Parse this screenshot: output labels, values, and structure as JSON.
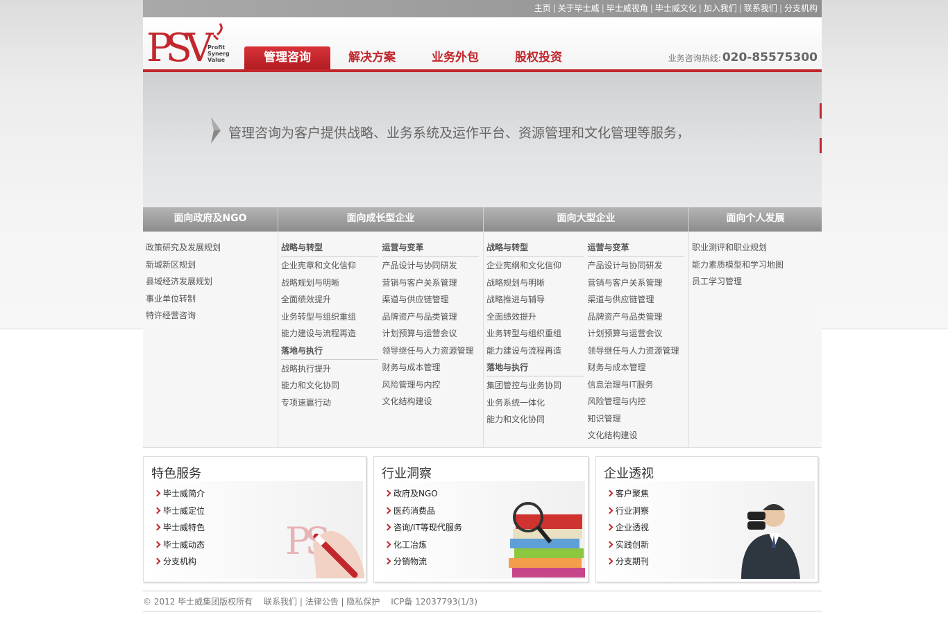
{
  "topbar": {
    "links": [
      "主页",
      "关于毕士威",
      "毕士威视角",
      "毕士威文化",
      "加入我们",
      "联系我们",
      "分支机构"
    ]
  },
  "logo": {
    "mark": "PSV",
    "tagline1": "Profit",
    "tagline2": "Synergy",
    "tagline3": "Value"
  },
  "nav": [
    {
      "label": "管理咨询"
    },
    {
      "label": "解决方案"
    },
    {
      "label": "业务外包"
    },
    {
      "label": "股权投资"
    }
  ],
  "hotline": {
    "label": "业务咨询热线:",
    "number": "020-85575300"
  },
  "banner": {
    "text": "管理咨询为客户提供战略、业务系统及运作平台、资源管理和文化管理等服务，"
  },
  "categories": [
    {
      "title": "面向政府及NGO",
      "items": [
        "政策研究及发展规划",
        "新城新区规划",
        "县域经济发展规划",
        "事业单位转制",
        "特许经营咨询"
      ]
    },
    {
      "title": "面向成长型企业",
      "left": {
        "head1": "战略与转型",
        "items1": [
          "企业宪章和文化信仰",
          "战略规划与明晰",
          "全面绩效提升",
          "业务转型与组织重组",
          "能力建设与流程再造"
        ],
        "head2": "落地与执行",
        "items2": [
          "战略执行提升",
          "能力和文化协同",
          "专项速赢行动"
        ]
      },
      "right": {
        "head1": "运营与变革",
        "items1": [
          "产品设计与协同研发",
          "营销与客户关系管理",
          "渠道与供应链管理",
          "品牌资产与品类管理",
          "计划预算与运营会议",
          "领导继任与人力资源管理",
          "财务与成本管理",
          "风险管理与内控",
          "文化结构建设"
        ]
      }
    },
    {
      "title": "面向大型企业",
      "left": {
        "head1": "战略与转型",
        "items1": [
          "企业宪纲和文化信仰",
          "战略规划与明晰",
          "战略推进与辅导",
          "全面绩效提升",
          "业务转型与组织重组",
          "能力建设与流程再造"
        ],
        "head2": "落地与执行",
        "items2": [
          "集团管控与业务协同",
          "业务系统一体化",
          "能力和文化协同"
        ]
      },
      "right": {
        "head1": "运营与变革",
        "items1": [
          "产品设计与协同研发",
          "营销与客户关系管理",
          "渠道与供应链管理",
          "品牌资产与品类管理",
          "计划预算与运营会议",
          "领导继任与人力资源管理",
          "财务与成本管理",
          "信息治理与IT服务",
          "风险管理与内控",
          "知识管理",
          "文化结构建设"
        ]
      }
    },
    {
      "title": "面向个人发展",
      "items": [
        "职业测评和职业规划",
        "能力素质模型和学习地图",
        "员工学习管理"
      ]
    }
  ],
  "boxes": [
    {
      "title": "特色服务",
      "items": [
        "毕士威简介",
        "毕士威定位",
        "毕士威特色",
        "毕士威动态",
        "分支机构"
      ]
    },
    {
      "title": "行业洞察",
      "items": [
        "政府及NGO",
        "医药消费品",
        "咨询/IT等现代服务",
        "化工冶炼",
        "分销物流"
      ]
    },
    {
      "title": "企业透视",
      "items": [
        "客户聚焦",
        "行业洞察",
        "企业透视",
        "实践创新",
        "分支期刊"
      ]
    }
  ],
  "footer": {
    "copyright": "© 2012 毕士威集团版权所有",
    "links": [
      "联系我们",
      "法律公告",
      "隐私保护"
    ],
    "icp": "ICP备 12037793(1/3)"
  },
  "colors": {
    "brand_red": "#c1272d",
    "header_gray": "#8f8f8f"
  }
}
